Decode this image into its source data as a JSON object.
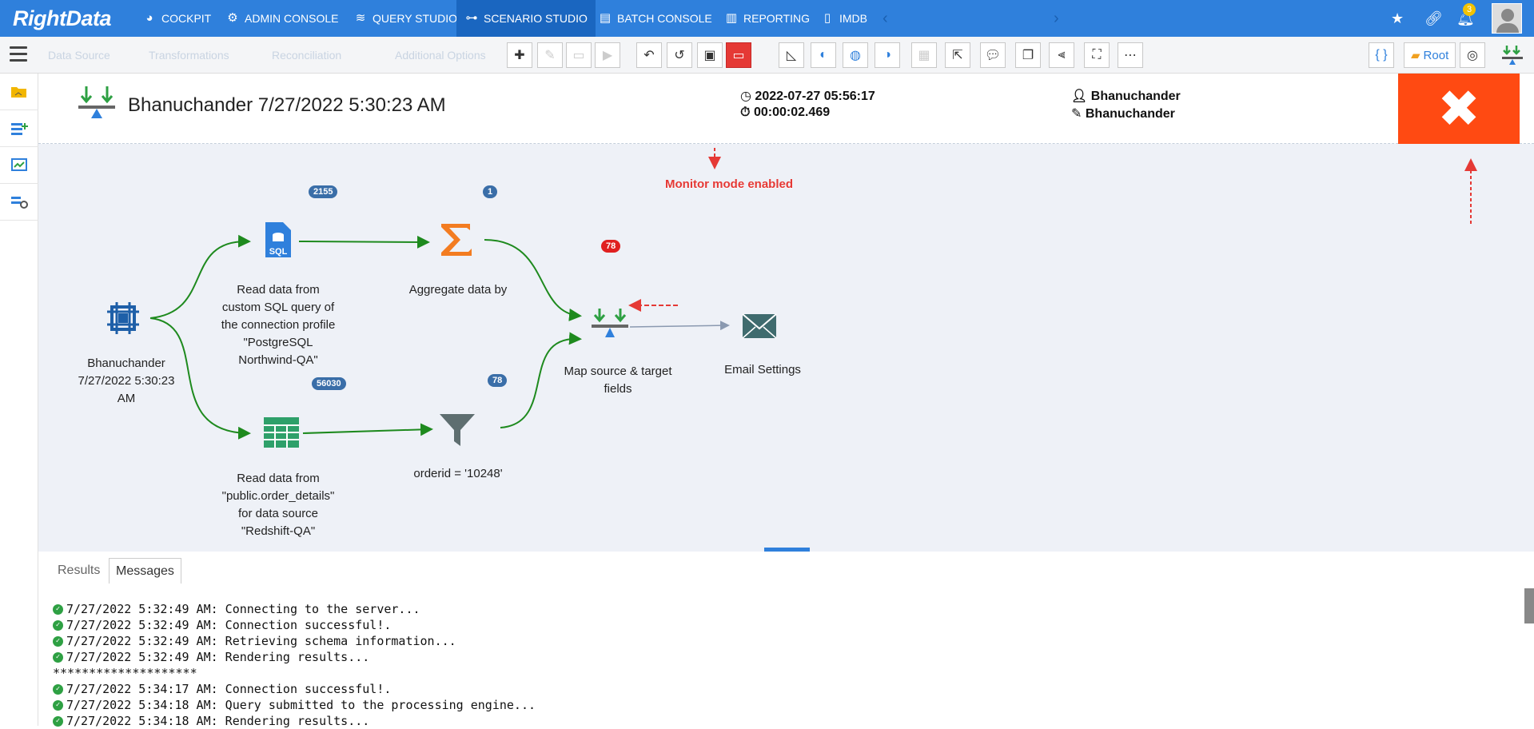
{
  "brand": {
    "logo": "RightData"
  },
  "nav": {
    "items": [
      {
        "label": "COCKPIT",
        "icon": "cockpit-icon"
      },
      {
        "label": "ADMIN CONSOLE",
        "icon": "gear-icon"
      },
      {
        "label": "QUERY STUDIO",
        "icon": "database-icon"
      },
      {
        "label": "SCENARIO STUDIO",
        "icon": "scenario-icon",
        "active": true
      },
      {
        "label": "BATCH CONSOLE",
        "icon": "batch-icon"
      },
      {
        "label": "REPORTING",
        "icon": "report-icon"
      },
      {
        "label": "IMDB",
        "icon": "imdb-icon"
      }
    ],
    "notifications_count": "3"
  },
  "toolbar": {
    "ghost_items": [
      "Data Source",
      "Transformations",
      "Reconciliation",
      "Additional Options"
    ],
    "root_label": "Root"
  },
  "header": {
    "title": "Bhanuchander 7/27/2022 5:30:23 AM",
    "start_time": "2022-07-27 05:56:17",
    "duration": "00:00:02.469",
    "created_by": "Bhanuchander",
    "modified_by": "Bhanuchander"
  },
  "canvas": {
    "monitor_note": "Monitor mode enabled",
    "nodes": {
      "start": {
        "label_lines": [
          "Bhanuchander",
          "7/27/2022 5:30:23",
          "AM"
        ]
      },
      "sql_source": {
        "label_lines": [
          "Read data from",
          "custom SQL query of",
          "the connection profile",
          "\"PostgreSQL",
          "Northwind-QA\""
        ],
        "count": "2155"
      },
      "aggregate": {
        "label_lines": [
          "Aggregate data by"
        ],
        "count": "1"
      },
      "table_source": {
        "label_lines": [
          "Read data from",
          "\"public.order_details\"",
          "for data source",
          "\"Redshift-QA\""
        ],
        "count": "56030"
      },
      "filter": {
        "label_lines": [
          "orderid = '10248'"
        ],
        "count": "78"
      },
      "map": {
        "label_lines": [
          "Map source & target",
          "fields"
        ],
        "count": "78"
      },
      "email": {
        "label_lines": [
          "Email Settings"
        ]
      }
    }
  },
  "bottom": {
    "tabs": [
      "Results",
      "Messages"
    ],
    "log": [
      {
        "check": true,
        "text": "7/27/2022 5:32:49 AM: Connecting to the server..."
      },
      {
        "check": true,
        "text": "7/27/2022 5:32:49 AM: Connection successful!."
      },
      {
        "check": true,
        "text": "7/27/2022 5:32:49 AM: Retrieving schema information..."
      },
      {
        "check": true,
        "text": "7/27/2022 5:32:49 AM: Rendering results..."
      },
      {
        "check": false,
        "text": "********************"
      },
      {
        "check": true,
        "text": "7/27/2022 5:34:17 AM: Connection successful!."
      },
      {
        "check": true,
        "text": "7/27/2022 5:34:18 AM: Query submitted to the processing engine..."
      },
      {
        "check": true,
        "text": "7/27/2022 5:34:18 AM: Rendering results..."
      }
    ]
  }
}
